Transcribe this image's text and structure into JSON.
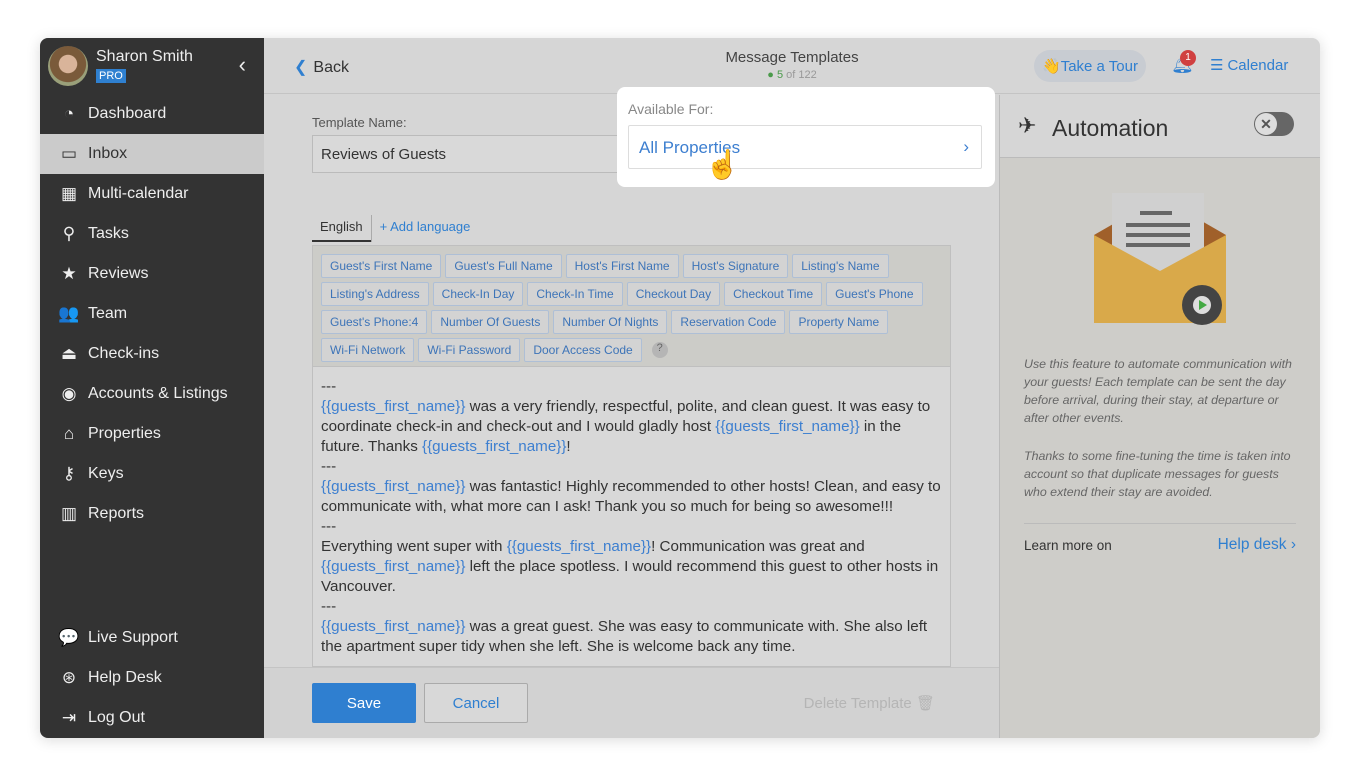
{
  "user": {
    "name": "Sharon Smith",
    "plan": "PRO"
  },
  "sidebar": {
    "items": [
      {
        "label": "Dashboard",
        "icon": "gauge-icon",
        "glyph": "◔"
      },
      {
        "label": "Inbox",
        "icon": "inbox-icon",
        "glyph": "▭",
        "active": true
      },
      {
        "label": "Multi-calendar",
        "icon": "calendar-icon",
        "glyph": "▦"
      },
      {
        "label": "Tasks",
        "icon": "mop-icon",
        "glyph": "⚲"
      },
      {
        "label": "Reviews",
        "icon": "star-icon",
        "glyph": "★"
      },
      {
        "label": "Team",
        "icon": "users-icon",
        "glyph": "👥"
      },
      {
        "label": "Check-ins",
        "icon": "bell-desk-icon",
        "glyph": "⏏"
      },
      {
        "label": "Accounts & Listings",
        "icon": "user-circle-icon",
        "glyph": "◉"
      },
      {
        "label": "Properties",
        "icon": "home-icon",
        "glyph": "⌂"
      },
      {
        "label": "Keys",
        "icon": "key-icon",
        "glyph": "⚷"
      },
      {
        "label": "Reports",
        "icon": "bar-chart-icon",
        "glyph": "▥"
      }
    ],
    "bottom": [
      {
        "label": "Live Support",
        "icon": "chat-icon",
        "glyph": "💬"
      },
      {
        "label": "Help Desk",
        "icon": "lifebuoy-icon",
        "glyph": "⊛"
      },
      {
        "label": "Log Out",
        "icon": "logout-icon",
        "glyph": "⇥"
      }
    ]
  },
  "header": {
    "back": "Back",
    "title": "Message Templates",
    "count": "5",
    "count_total": "of 122",
    "tour": "Take a Tour",
    "notifications": "1",
    "calendar": "Calendar"
  },
  "form": {
    "name_label": "Template Name:",
    "name_value": "Reviews of Guests",
    "lang_tab": "English",
    "add_language": "+ Add language",
    "tags": [
      "Guest's First Name",
      "Guest's Full Name",
      "Host's First Name",
      "Host's Signature",
      "Listing's Name",
      "Listing's Address",
      "Check-In Day",
      "Check-In Time",
      "Checkout Day",
      "Checkout Time",
      "Guest's Phone",
      "Guest's Phone:4",
      "Number Of Guests",
      "Number Of Nights",
      "Reservation Code",
      "Property Name",
      "Wi-Fi Network",
      "Wi-Fi Password",
      "Door Access Code"
    ],
    "help": "?",
    "body": [
      [
        {
          "t": "---"
        }
      ],
      [
        {
          "t": "{{guests_first_name}}",
          "tok": true
        },
        {
          "t": " was a very friendly, respectful, polite, and clean guest. It was easy to coordinate check-in and check-out and I would gladly host "
        },
        {
          "t": "{{guests_first_name}}",
          "tok": true
        },
        {
          "t": " in the future. Thanks "
        },
        {
          "t": "{{guests_first_name}}",
          "tok": true
        },
        {
          "t": "!"
        }
      ],
      [
        {
          "t": "---"
        }
      ],
      [
        {
          "t": "{{guests_first_name}}",
          "tok": true
        },
        {
          "t": " was fantastic! Highly recommended to other hosts! Clean, and easy to communicate with, what more can I ask! Thank you so much for being so awesome!!!"
        }
      ],
      [
        {
          "t": "---"
        }
      ],
      [
        {
          "t": "Everything went super with "
        },
        {
          "t": "{{guests_first_name}}",
          "tok": true
        },
        {
          "t": "! Communication was great and "
        },
        {
          "t": "{{guests_first_name}}",
          "tok": true
        },
        {
          "t": " left the place spotless. I would recommend this guest to other hosts in Vancouver."
        }
      ],
      [
        {
          "t": "---"
        }
      ],
      [
        {
          "t": "{{guests_first_name}}",
          "tok": true
        },
        {
          "t": "  was a great guest. She was easy to communicate with.  She also left the apartment super tidy when she left. She is  welcome back any time."
        }
      ]
    ],
    "save": "Save",
    "cancel": "Cancel",
    "delete": "Delete Template"
  },
  "popup": {
    "label": "Available For:",
    "value": "All Properties"
  },
  "automation": {
    "title": "Automation",
    "enabled": false,
    "text1": "Use this feature to automate communication with your guests! Each template can be sent the day before arrival, during their stay, at departure or after other events.",
    "text2": "Thanks to some fine-tuning the time is taken into account so that duplicate messages for guests who extend their stay are avoided.",
    "learn": "Learn more on",
    "helpdesk": "Help desk"
  },
  "colors": {
    "accent": "#2f7fd0",
    "sidebar": "#333333",
    "badge": "#d04040"
  }
}
